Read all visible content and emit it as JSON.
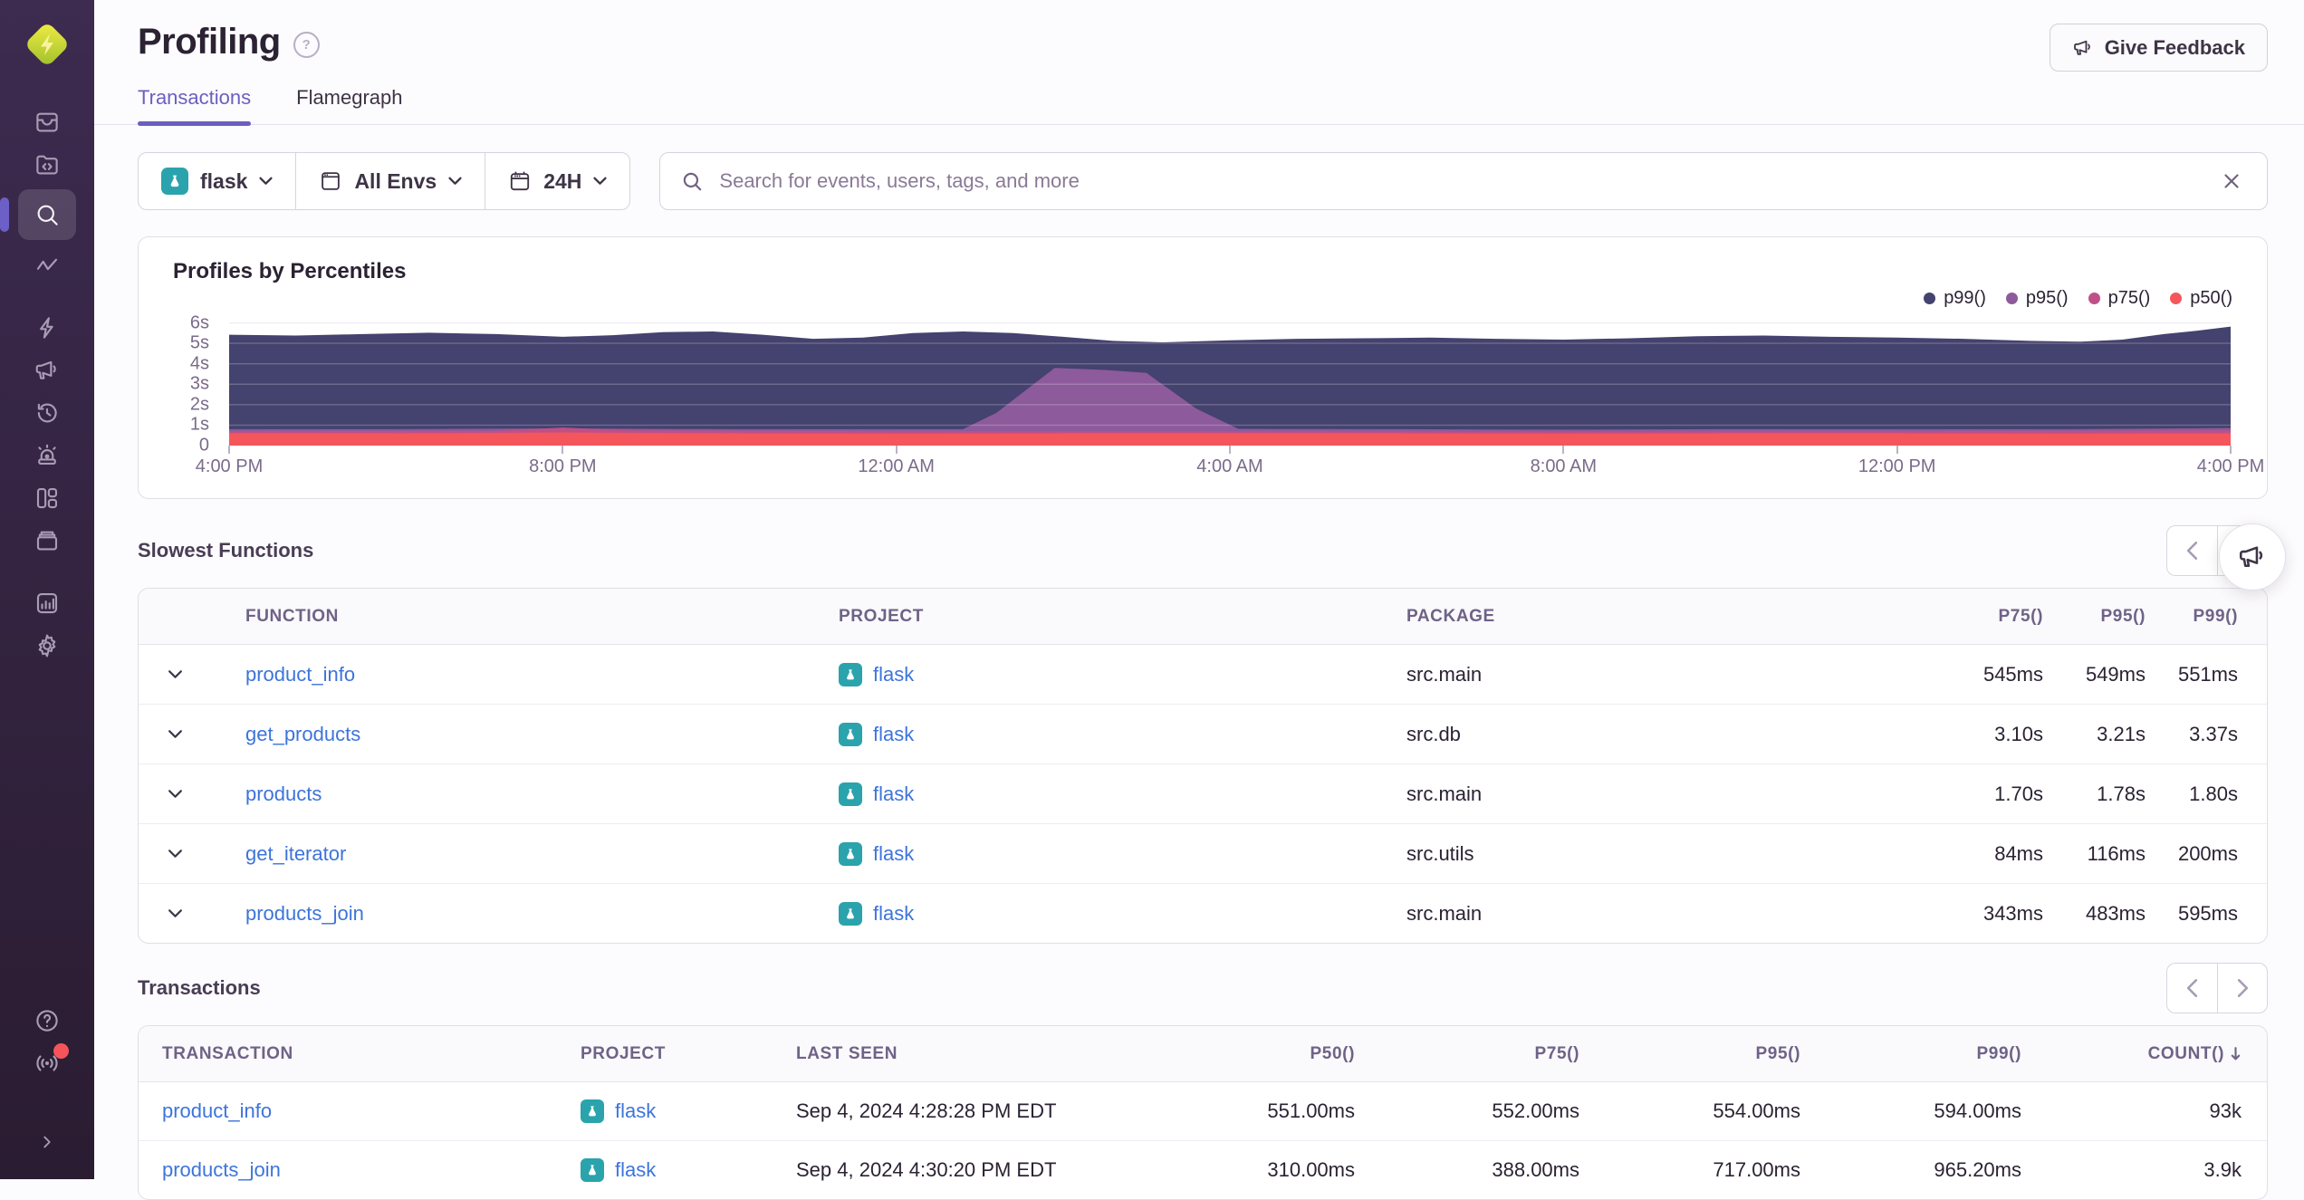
{
  "header": {
    "title": "Profiling",
    "feedback_button": "Give Feedback"
  },
  "tabs": [
    {
      "label": "Transactions",
      "active": true
    },
    {
      "label": "Flamegraph",
      "active": false
    }
  ],
  "filters": {
    "project": "flask",
    "environment": "All Envs",
    "date_range": "24H"
  },
  "search": {
    "placeholder": "Search for events, users, tags, and more"
  },
  "chart_data": {
    "type": "area",
    "title": "Profiles by Percentiles",
    "x_unit": "hours offset from 4:00 PM (24h window)",
    "x_range": [
      0,
      24
    ],
    "xticks": [
      "4:00 PM",
      "8:00 PM",
      "12:00 AM",
      "4:00 AM",
      "8:00 AM",
      "12:00 PM",
      "4:00 PM"
    ],
    "yticks": [
      "0",
      "1s",
      "2s",
      "3s",
      "4s",
      "5s",
      "6s"
    ],
    "ylim": [
      0,
      6.2
    ],
    "grid": true,
    "legend_position": "top-right",
    "series": [
      {
        "name": "p99()",
        "color": "#44426e",
        "points": [
          [
            0,
            5.42
          ],
          [
            0.8,
            5.38
          ],
          [
            1.6,
            5.45
          ],
          [
            2.4,
            5.52
          ],
          [
            3.2,
            5.45
          ],
          [
            4.0,
            5.32
          ],
          [
            4.6,
            5.4
          ],
          [
            5.2,
            5.55
          ],
          [
            5.8,
            5.58
          ],
          [
            6.4,
            5.42
          ],
          [
            7.0,
            5.22
          ],
          [
            7.6,
            5.28
          ],
          [
            8.2,
            5.5
          ],
          [
            8.8,
            5.58
          ],
          [
            9.4,
            5.5
          ],
          [
            10.0,
            5.32
          ],
          [
            10.6,
            5.12
          ],
          [
            11.2,
            5.05
          ],
          [
            12.0,
            5.15
          ],
          [
            12.8,
            5.22
          ],
          [
            13.6,
            5.25
          ],
          [
            14.4,
            5.28
          ],
          [
            15.2,
            5.22
          ],
          [
            16.0,
            5.18
          ],
          [
            16.8,
            5.25
          ],
          [
            17.6,
            5.35
          ],
          [
            18.4,
            5.38
          ],
          [
            19.2,
            5.32
          ],
          [
            20.0,
            5.28
          ],
          [
            20.8,
            5.22
          ],
          [
            21.6,
            5.12
          ],
          [
            22.2,
            5.08
          ],
          [
            22.7,
            5.18
          ],
          [
            23.2,
            5.45
          ],
          [
            23.6,
            5.62
          ],
          [
            24,
            5.82
          ]
        ]
      },
      {
        "name": "p95()",
        "color": "#8d5a9c",
        "points": [
          [
            0,
            0.8
          ],
          [
            2,
            0.8
          ],
          [
            4,
            0.84
          ],
          [
            6,
            0.8
          ],
          [
            8.8,
            0.8
          ],
          [
            9.2,
            1.6
          ],
          [
            9.9,
            3.8
          ],
          [
            10.5,
            3.7
          ],
          [
            11.0,
            3.55
          ],
          [
            11.6,
            1.8
          ],
          [
            12.1,
            0.82
          ],
          [
            14,
            0.8
          ],
          [
            16,
            0.78
          ],
          [
            18,
            0.8
          ],
          [
            20,
            0.8
          ],
          [
            22,
            0.8
          ],
          [
            24,
            0.86
          ]
        ]
      },
      {
        "name": "p75()",
        "color": "#bf5087",
        "points": [
          [
            0,
            0.7
          ],
          [
            3.2,
            0.72
          ],
          [
            4.0,
            0.88
          ],
          [
            4.8,
            0.74
          ],
          [
            8,
            0.7
          ],
          [
            12,
            0.7
          ],
          [
            16,
            0.68
          ],
          [
            20,
            0.7
          ],
          [
            24,
            0.74
          ]
        ]
      },
      {
        "name": "p50()",
        "color": "#f4565c",
        "points": [
          [
            0,
            0.6
          ],
          [
            2,
            0.6
          ],
          [
            4,
            0.64
          ],
          [
            6,
            0.6
          ],
          [
            8,
            0.58
          ],
          [
            10,
            0.6
          ],
          [
            12,
            0.6
          ],
          [
            14,
            0.6
          ],
          [
            16,
            0.58
          ],
          [
            18,
            0.6
          ],
          [
            20,
            0.6
          ],
          [
            22,
            0.58
          ],
          [
            24,
            0.6
          ]
        ]
      }
    ]
  },
  "slowest_functions": {
    "title": "Slowest Functions",
    "columns": [
      "FUNCTION",
      "PROJECT",
      "PACKAGE",
      "P75()",
      "P95()",
      "P99()"
    ],
    "rows": [
      {
        "function": "product_info",
        "project": "flask",
        "package": "src.main",
        "p75": "545ms",
        "p95": "549ms",
        "p99": "551ms"
      },
      {
        "function": "get_products",
        "project": "flask",
        "package": "src.db",
        "p75": "3.10s",
        "p95": "3.21s",
        "p99": "3.37s"
      },
      {
        "function": "products",
        "project": "flask",
        "package": "src.main",
        "p75": "1.70s",
        "p95": "1.78s",
        "p99": "1.80s"
      },
      {
        "function": "get_iterator",
        "project": "flask",
        "package": "src.utils",
        "p75": "84ms",
        "p95": "116ms",
        "p99": "200ms"
      },
      {
        "function": "products_join",
        "project": "flask",
        "package": "src.main",
        "p75": "343ms",
        "p95": "483ms",
        "p99": "595ms"
      }
    ]
  },
  "transactions": {
    "title": "Transactions",
    "columns": [
      "TRANSACTION",
      "PROJECT",
      "LAST SEEN",
      "P50()",
      "P75()",
      "P95()",
      "P99()",
      "COUNT()"
    ],
    "sort_column": "COUNT()",
    "sort_direction": "desc",
    "rows": [
      {
        "transaction": "product_info",
        "project": "flask",
        "last_seen": "Sep 4, 2024 4:28:28 PM EDT",
        "p50": "551.00ms",
        "p75": "552.00ms",
        "p95": "554.00ms",
        "p99": "594.00ms",
        "count": "93k"
      },
      {
        "transaction": "products_join",
        "project": "flask",
        "last_seen": "Sep 4, 2024 4:30:20 PM EDT",
        "p50": "310.00ms",
        "p75": "388.00ms",
        "p95": "717.00ms",
        "p99": "965.20ms",
        "count": "3.9k"
      }
    ]
  }
}
